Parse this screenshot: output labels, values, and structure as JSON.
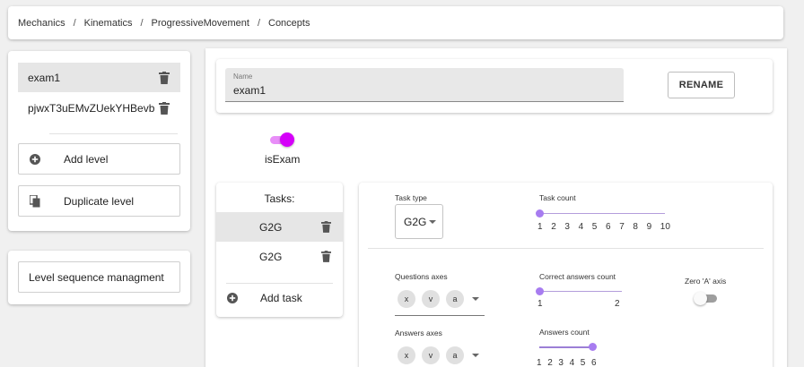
{
  "breadcrumb": {
    "items": [
      "Mechanics",
      "Kinematics",
      "ProgressiveMovement",
      "Concepts"
    ],
    "separator": "/"
  },
  "levels": {
    "items": [
      {
        "label": "exam1",
        "selected": true
      },
      {
        "label": "pjwxT3uEMvZUekYHBevb",
        "selected": false
      }
    ],
    "add_label": "Add level",
    "duplicate_label": "Duplicate level",
    "sequence_label": "Level sequence managment"
  },
  "level_editor": {
    "name_label": "Name",
    "name_value": "exam1",
    "rename_label": "RENAME",
    "is_exam_label": "isExam",
    "is_exam_checked": true
  },
  "tasks": {
    "header": "Tasks:",
    "items": [
      {
        "label": "G2G",
        "selected": true
      },
      {
        "label": "G2G",
        "selected": false
      }
    ],
    "add_label": "Add task"
  },
  "task_settings": {
    "task_type_label": "Task type",
    "task_type_value": "G2G",
    "task_count_label": "Task count",
    "task_count_marks": [
      "1",
      "2",
      "3",
      "4",
      "5",
      "6",
      "7",
      "8",
      "9",
      "10"
    ],
    "task_count_value": 1,
    "questions_axes_label": "Questions axes",
    "questions_axes": [
      "x",
      "v",
      "a"
    ],
    "correct_answers_label": "Correct answers count",
    "correct_answers_marks": [
      "1",
      "2"
    ],
    "correct_answers_value": 1,
    "zero_a_axis_label": "Zero 'A' axis",
    "zero_a_axis_checked": false,
    "answers_axes_label": "Answers axes",
    "answers_axes": [
      "x",
      "v",
      "a"
    ],
    "answers_count_label": "Answers count",
    "answers_count_marks": [
      "1",
      "2",
      "3",
      "4",
      "5",
      "6"
    ],
    "answers_count_value": 6
  },
  "colors": {
    "accent": "#d500f9",
    "slider": "#b388ff",
    "slider_track": "#9c7fd6"
  }
}
